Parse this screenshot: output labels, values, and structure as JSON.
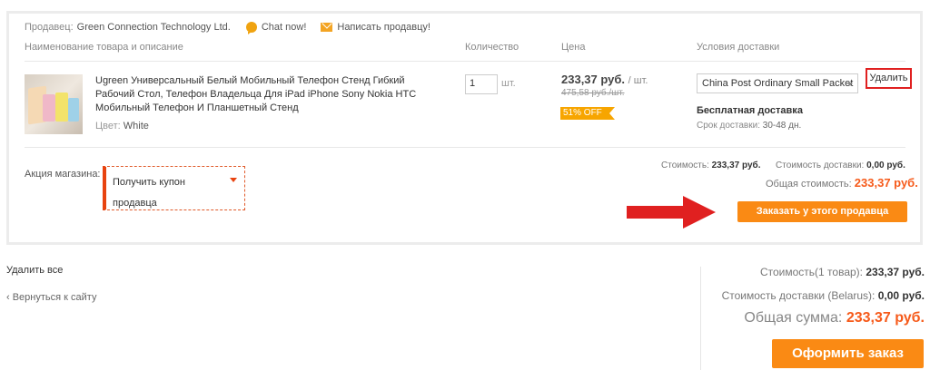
{
  "seller": {
    "label": "Продавец:",
    "name": "Green Connection Technology Ltd.",
    "chat_label": "Chat now!",
    "message_label": "Написать продавцу!"
  },
  "columns": {
    "product": "Наименование товара и описание",
    "quantity": "Количество",
    "price": "Цена",
    "shipping": "Условия доставки"
  },
  "item": {
    "title": "Ugreen Универсальный Белый Мобильный Телефон Стенд Гибкий Рабочий Стол, Телефон Владельца Для iPad iPhone Sony Nokia HTC Мобильный Телефон И Планшетный Стенд",
    "color_label": "Цвет:",
    "color_value": "White",
    "quantity": "1",
    "quantity_unit": "шт.",
    "price": "233,37 руб.",
    "price_unit": "/ шт.",
    "old_price": "475,58 руб./шт.",
    "discount": "51% OFF",
    "shipping_method": "China Post Ordinary Small Packet",
    "delete_label": "Удалить",
    "free_shipping": "Бесплатная доставка",
    "delivery_label": "Срок доставки:",
    "delivery_value": "30-48 дн."
  },
  "promo": {
    "label": "Акция магазина:",
    "coupon_text": "Получить купон продавца"
  },
  "store_summary": {
    "cost_label": "Стоимость:",
    "cost_value": "233,37 руб.",
    "shipping_label": "Стоимость доставки:",
    "shipping_value": "0,00 руб.",
    "total_label": "Общая стоимость:",
    "total_value": "233,37 руб.",
    "order_button": "Заказать у этого продавца"
  },
  "footer": {
    "delete_all": "Удалить все",
    "back": "‹ Вернуться к сайту",
    "items_cost_label": "Стоимость(1 товар):",
    "items_cost_value": "233,37 руб.",
    "shipping_label": "Стоимость доставки (Belarus):",
    "shipping_value": "0,00 руб.",
    "grand_total_label": "Общая сумма:",
    "grand_total_value": "233,37 руб.",
    "checkout_button": "Оформить заказ"
  },
  "colors": {
    "accent_orange": "#fa8a14",
    "price_orange": "#f65a1a",
    "highlight_red": "#e02020",
    "discount_badge": "#f7a500"
  }
}
